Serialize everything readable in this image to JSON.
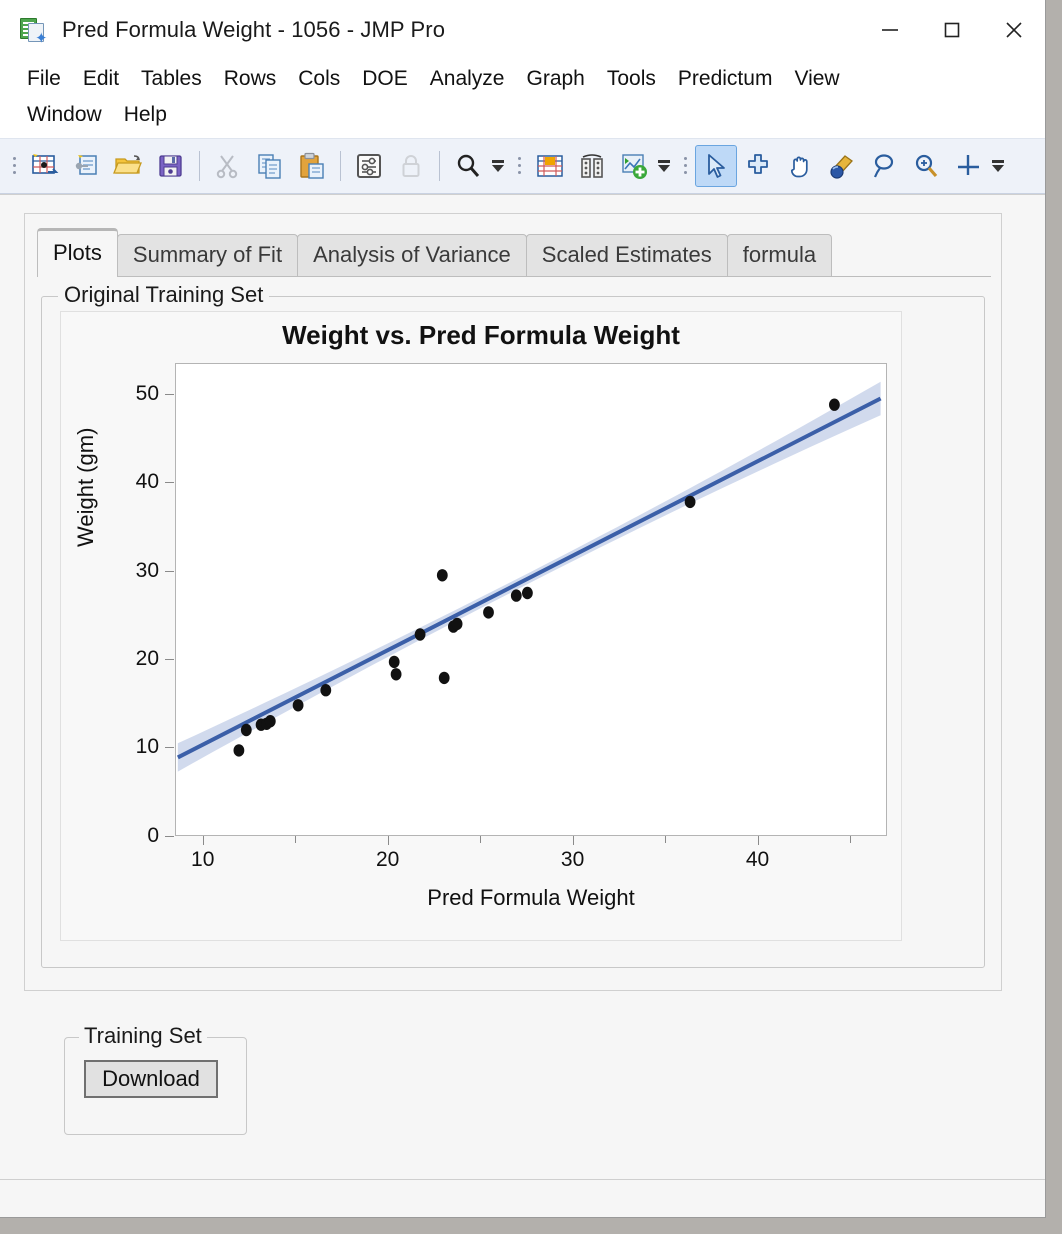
{
  "window": {
    "title": "Pred Formula Weight - 1056 - JMP Pro",
    "app_icon": "jmp-document-icon",
    "controls": {
      "minimize": "minimize-icon",
      "maximize": "maximize-icon",
      "close": "close-icon"
    }
  },
  "menubar": {
    "items": [
      "File",
      "Edit",
      "Tables",
      "Rows",
      "Cols",
      "DOE",
      "Analyze",
      "Graph",
      "Tools",
      "Predictum",
      "View",
      "Window",
      "Help"
    ]
  },
  "toolbar": {
    "groups": [
      {
        "name": "file-group",
        "buttons": [
          "new-data-table-icon",
          "new-script-icon",
          "open-folder-icon",
          "save-icon",
          "separator",
          "cut-icon",
          "copy-icon",
          "paste-icon",
          "separator",
          "preferences-icon",
          "lock-icon",
          "separator",
          "search-icon"
        ],
        "overflow": "toolbar-overflow-icon"
      },
      {
        "name": "table-group",
        "buttons": [
          "data-table-icon",
          "column-viewer-icon",
          "add-graph-icon"
        ],
        "overflow": "toolbar-overflow-icon"
      },
      {
        "name": "tools-group",
        "buttons": [
          "arrow-select-icon",
          "crosshair-select-icon",
          "hand-pan-icon",
          "brush-icon",
          "lasso-icon",
          "magnifier-zoom-icon",
          "crosshair-icon"
        ],
        "overflow": "toolbar-overflow-icon",
        "selected": "arrow-select-icon"
      }
    ]
  },
  "tabs": [
    {
      "label": "Plots",
      "active": true
    },
    {
      "label": "Summary of Fit",
      "active": false
    },
    {
      "label": "Analysis of Variance",
      "active": false
    },
    {
      "label": "Scaled Estimates",
      "active": false
    },
    {
      "label": "formula",
      "active": false
    }
  ],
  "groups": {
    "original_training_set": {
      "legend": "Original Training Set"
    },
    "training_set": {
      "legend": "Training Set",
      "download_label": "Download"
    }
  },
  "colors": {
    "fit_line": "#3b5fa8",
    "confidence_band": "#c9d4ea",
    "point": "#111111",
    "toolbar_bg": "#eef2f9",
    "panel_bg": "#f6f6f6",
    "tab_inactive_bg": "#e3e3e3"
  },
  "chart_data": {
    "type": "scatter",
    "title": "Weight vs. Pred Formula Weight",
    "xlabel": "Pred Formula Weight",
    "ylabel": "Weight (gm)",
    "xlim": [
      8.5,
      47
    ],
    "ylim": [
      0,
      53.5
    ],
    "xticks": [
      10,
      20,
      30,
      40
    ],
    "xticks_minor": [
      15,
      25,
      35,
      45
    ],
    "yticks": [
      0,
      10,
      20,
      30,
      40,
      50
    ],
    "grid": false,
    "legend": "none",
    "points": [
      {
        "x": 11.9,
        "y": 9.8
      },
      {
        "x": 12.3,
        "y": 12.1
      },
      {
        "x": 13.1,
        "y": 12.7
      },
      {
        "x": 13.4,
        "y": 12.8
      },
      {
        "x": 13.6,
        "y": 13.1
      },
      {
        "x": 15.1,
        "y": 14.9
      },
      {
        "x": 16.6,
        "y": 16.6
      },
      {
        "x": 20.3,
        "y": 19.8
      },
      {
        "x": 20.4,
        "y": 18.4
      },
      {
        "x": 21.7,
        "y": 22.9
      },
      {
        "x": 22.9,
        "y": 29.6
      },
      {
        "x": 23.0,
        "y": 18.0
      },
      {
        "x": 23.5,
        "y": 23.8
      },
      {
        "x": 23.7,
        "y": 24.1
      },
      {
        "x": 25.4,
        "y": 25.4
      },
      {
        "x": 26.9,
        "y": 27.3
      },
      {
        "x": 27.5,
        "y": 27.6
      },
      {
        "x": 36.3,
        "y": 37.9
      },
      {
        "x": 44.1,
        "y": 48.9
      }
    ],
    "fit_line": {
      "type": "linear-regression",
      "x_start": 8.6,
      "y_start": 9.0,
      "x_end": 46.6,
      "y_end": 49.6
    },
    "confidence_band": {
      "label": "confidence interval of fit",
      "half_width_at_x_start": 1.6,
      "half_width_at_mid": 0.6,
      "half_width_at_x_end": 1.9
    }
  }
}
